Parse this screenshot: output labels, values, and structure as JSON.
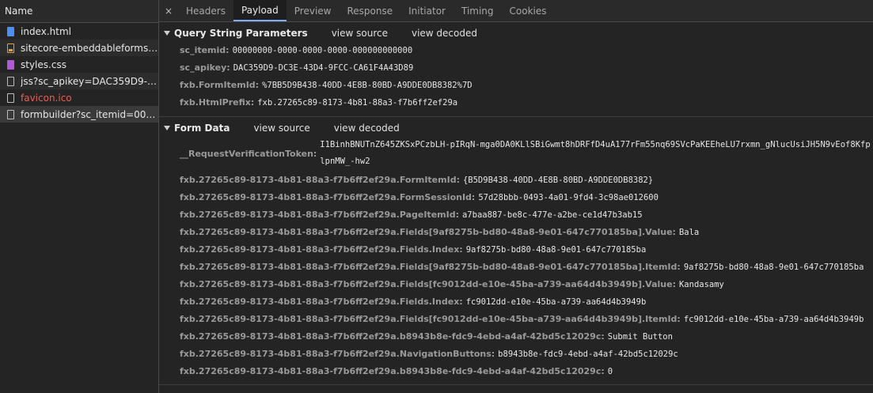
{
  "name_panel": {
    "header": "Name",
    "files": [
      {
        "name": "index.html",
        "icon": "document-icon"
      },
      {
        "name": "sitecore-embeddableforms.u...",
        "icon": "script-icon"
      },
      {
        "name": "styles.css",
        "icon": "stylesheet-icon"
      },
      {
        "name": "jss?sc_apikey=DAC359D9-DC...",
        "icon": "blank-file-icon"
      },
      {
        "name": "favicon.ico",
        "icon": "blank-file-icon",
        "error": true
      },
      {
        "name": "formbuilder?sc_itemid=00000...",
        "icon": "blank-file-icon",
        "selected": true
      }
    ]
  },
  "tabs": {
    "close": "×",
    "items": [
      "Headers",
      "Payload",
      "Preview",
      "Response",
      "Initiator",
      "Timing",
      "Cookies"
    ],
    "active": "Payload"
  },
  "query": {
    "title": "Query String Parameters",
    "view_source": "view source",
    "view_decoded": "view decoded",
    "params": [
      {
        "key": "sc_itemid:",
        "value": "00000000-0000-0000-0000-000000000000"
      },
      {
        "key": "sc_apikey:",
        "value": "DAC359D9-DC3E-43D4-9FCC-CA61F4A43D89"
      },
      {
        "key": "fxb.FormItemId:",
        "value": "%7BB5D9B438-40DD-4E8B-80BD-A9DDE0DB8382%7D"
      },
      {
        "key": "fxb.HtmlPrefix:",
        "value": "fxb.27265c89-8173-4b81-88a3-f7b6ff2ef29a"
      }
    ]
  },
  "form": {
    "title": "Form Data",
    "view_source": "view source",
    "view_decoded": "view decoded",
    "token": {
      "key": "__RequestVerificationToken:",
      "line1": "I1BinhBNUTnZ645ZKSxPCzbLH-pIRqN-mga0DA0KLlSBiGwmt8hDRFfD4uA177rFm55nq69SVcPaKEEheLU7rxmn_gNlucUsiJH5N9vEof8Kfp",
      "line2": "lpnMW_-hw2"
    },
    "params": [
      {
        "key": "fxb.27265c89-8173-4b81-88a3-f7b6ff2ef29a.FormItemId:",
        "value": "{B5D9B438-40DD-4E8B-80BD-A9DDE0DB8382}"
      },
      {
        "key": "fxb.27265c89-8173-4b81-88a3-f7b6ff2ef29a.FormSessionId:",
        "value": "57d28bbb-0493-4a01-9fd4-3c98ae012600"
      },
      {
        "key": "fxb.27265c89-8173-4b81-88a3-f7b6ff2ef29a.PageItemId:",
        "value": "a7baa887-be8c-477e-a2be-ce1d47b3ab15"
      },
      {
        "key": "fxb.27265c89-8173-4b81-88a3-f7b6ff2ef29a.Fields[9af8275b-bd80-48a8-9e01-647c770185ba].Value:",
        "value": "Bala"
      },
      {
        "key": "fxb.27265c89-8173-4b81-88a3-f7b6ff2ef29a.Fields.Index:",
        "value": "9af8275b-bd80-48a8-9e01-647c770185ba"
      },
      {
        "key": "fxb.27265c89-8173-4b81-88a3-f7b6ff2ef29a.Fields[9af8275b-bd80-48a8-9e01-647c770185ba].ItemId:",
        "value": "9af8275b-bd80-48a8-9e01-647c770185ba"
      },
      {
        "key": "fxb.27265c89-8173-4b81-88a3-f7b6ff2ef29a.Fields[fc9012dd-e10e-45ba-a739-aa64d4b3949b].Value:",
        "value": "Kandasamy"
      },
      {
        "key": "fxb.27265c89-8173-4b81-88a3-f7b6ff2ef29a.Fields.Index:",
        "value": "fc9012dd-e10e-45ba-a739-aa64d4b3949b"
      },
      {
        "key": "fxb.27265c89-8173-4b81-88a3-f7b6ff2ef29a.Fields[fc9012dd-e10e-45ba-a739-aa64d4b3949b].ItemId:",
        "value": "fc9012dd-e10e-45ba-a739-aa64d4b3949b"
      },
      {
        "key": "fxb.27265c89-8173-4b81-88a3-f7b6ff2ef29a.b8943b8e-fdc9-4ebd-a4af-42bd5c12029c:",
        "value": "Submit Button"
      },
      {
        "key": "fxb.27265c89-8173-4b81-88a3-f7b6ff2ef29a.NavigationButtons:",
        "value": "b8943b8e-fdc9-4ebd-a4af-42bd5c12029c"
      },
      {
        "key": "fxb.27265c89-8173-4b81-88a3-f7b6ff2ef29a.b8943b8e-fdc9-4ebd-a4af-42bd5c12029c:",
        "value": "0"
      }
    ]
  },
  "colors": {
    "background": "#242424",
    "active_tab_underline": "#7cacf8",
    "error_text": "#ec5d54"
  }
}
